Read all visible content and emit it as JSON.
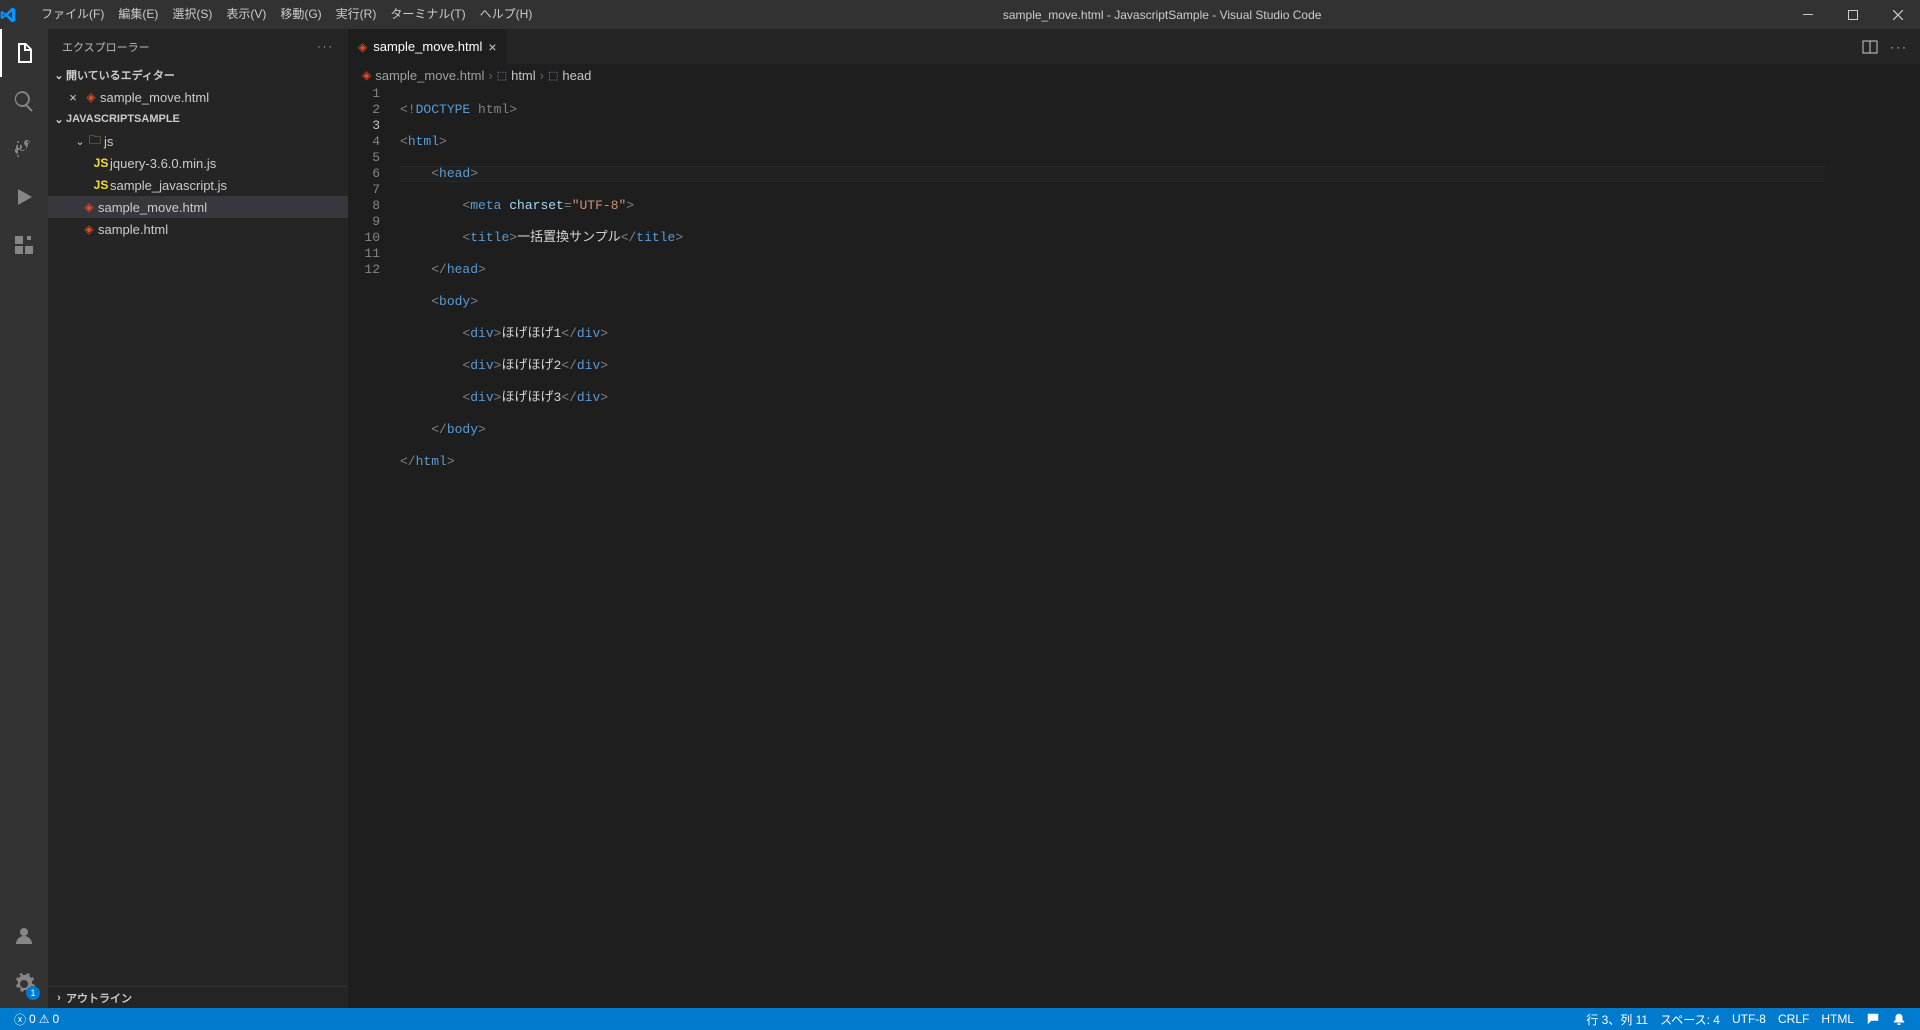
{
  "title": "sample_move.html - JavascriptSample - Visual Studio Code",
  "menu": [
    "ファイル(F)",
    "編集(E)",
    "選択(S)",
    "表示(V)",
    "移動(G)",
    "実行(R)",
    "ターミナル(T)",
    "ヘルプ(H)"
  ],
  "sidebar": {
    "title": "エクスプローラー",
    "openEditorsLabel": "開いているエディター",
    "openEditors": [
      {
        "name": "sample_move.html"
      }
    ],
    "workspaceLabel": "JAVASCRIPTSAMPLE",
    "tree": {
      "folder_js": "js",
      "files_js": [
        "jquery-3.6.0.min.js",
        "sample_javascript.js"
      ],
      "files_root": [
        "sample_move.html",
        "sample.html"
      ]
    },
    "outlineLabel": "アウトライン"
  },
  "tab": {
    "name": "sample_move.html"
  },
  "breadcrumb": {
    "file": "sample_move.html",
    "node1": "html",
    "node2": "head"
  },
  "settingsBadge": "1",
  "code": {
    "l1": {
      "a": "<!",
      "b": "DOCTYPE",
      "c": " html",
      "d": ">"
    },
    "l2": {
      "a": "<",
      "b": "html",
      "c": ">"
    },
    "l3": {
      "a": "<",
      "b": "head",
      "c": ">"
    },
    "l4": {
      "a": "<",
      "b": "meta",
      "c": " charset",
      "d": "=",
      "e": "\"UTF-8\"",
      "f": ">"
    },
    "l5": {
      "a": "<",
      "b": "title",
      "c": ">",
      "d": "一括置換サンプル",
      "e": "</",
      "f": "title",
      "g": ">"
    },
    "l6": {
      "a": "</",
      "b": "head",
      "c": ">"
    },
    "l7": {
      "a": "<",
      "b": "body",
      "c": ">"
    },
    "l8": {
      "a": "<",
      "b": "div",
      "c": ">",
      "d": "ほげほげ1",
      "e": "</",
      "f": "div",
      "g": ">"
    },
    "l9": {
      "a": "<",
      "b": "div",
      "c": ">",
      "d": "ほげほげ2",
      "e": "</",
      "f": "div",
      "g": ">"
    },
    "l10": {
      "a": "<",
      "b": "div",
      "c": ">",
      "d": "ほげほげ3",
      "e": "</",
      "f": "div",
      "g": ">"
    },
    "l11": {
      "a": "</",
      "b": "body",
      "c": ">"
    },
    "l12": {
      "a": "</",
      "b": "html",
      "c": ">"
    }
  },
  "status": {
    "errors": "0",
    "warnings": "0",
    "pos": "行 3、列 11",
    "spaces": "スペース: 4",
    "encoding": "UTF-8",
    "eol": "CRLF",
    "lang": "HTML"
  }
}
